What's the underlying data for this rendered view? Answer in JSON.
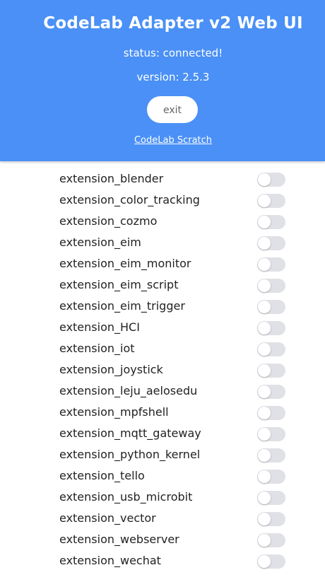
{
  "header": {
    "title": "CodeLab Adapter v2 Web UI",
    "status": "status: connected!",
    "version": "version: 2.5.3",
    "exit_label": "exit",
    "scratch_link": "CodeLab Scratch",
    "background_color": "#4a90f6"
  },
  "extensions": [
    {
      "name": "extension_blender",
      "enabled": false
    },
    {
      "name": "extension_color_tracking",
      "enabled": false
    },
    {
      "name": "extension_cozmo",
      "enabled": false
    },
    {
      "name": "extension_eim",
      "enabled": false
    },
    {
      "name": "extension_eim_monitor",
      "enabled": false
    },
    {
      "name": "extension_eim_script",
      "enabled": false
    },
    {
      "name": "extension_eim_trigger",
      "enabled": false
    },
    {
      "name": "extension_HCI",
      "enabled": false
    },
    {
      "name": "extension_iot",
      "enabled": false
    },
    {
      "name": "extension_joystick",
      "enabled": false
    },
    {
      "name": "extension_leju_aelosedu",
      "enabled": false
    },
    {
      "name": "extension_mpfshell",
      "enabled": false
    },
    {
      "name": "extension_mqtt_gateway",
      "enabled": false
    },
    {
      "name": "extension_python_kernel",
      "enabled": false
    },
    {
      "name": "extension_tello",
      "enabled": false
    },
    {
      "name": "extension_usb_microbit",
      "enabled": false
    },
    {
      "name": "extension_vector",
      "enabled": false
    },
    {
      "name": "extension_webserver",
      "enabled": false
    },
    {
      "name": "extension_wechat",
      "enabled": false
    }
  ]
}
